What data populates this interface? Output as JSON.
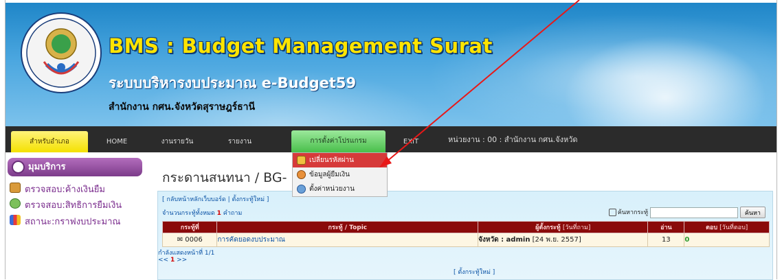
{
  "banner": {
    "title": "BMS : Budget Management Surat",
    "subtitle": "ระบบบริหารงบประมาณ e-Budget59",
    "office": "สำนักงาน กศน.จังหวัดสุราษฎร์ธานี"
  },
  "menu": {
    "items": [
      {
        "label": "สำหรับอำเภอ"
      },
      {
        "label": "HOME"
      },
      {
        "label": "งานรายวัน"
      },
      {
        "label": "รายงาน"
      },
      {
        "label": "การตั้งค่าโปรแกรม"
      },
      {
        "label": "EXIT"
      }
    ],
    "unit": "หน่วยงาน : 00 : สำนักงาน กศน.จังหวัด"
  },
  "dropdown": {
    "items": [
      {
        "label": "เปลี่ยนรหัสผ่าน"
      },
      {
        "label": "ข้อมูลผู้ยืมเงิน"
      },
      {
        "label": "ตั้งค่าหน่วยงาน"
      }
    ]
  },
  "sidebar": {
    "header": "มุมบริการ",
    "links": [
      {
        "label": "ตรวจสอบ:ค้างเงินยืม"
      },
      {
        "label": "ตรวจสอบ:สิทธิการยืมเงิน"
      },
      {
        "label": "สถานะ:กราฟงบประมาณ"
      }
    ]
  },
  "main": {
    "title": "กระดานสนทนา / BG-",
    "nav_links": "[ กลับหน้าหลักเว็บบอร์ด | ตั้งกระทู้ใหม่ ]",
    "count_prefix": "จำนวนกระทู้ทั้งหมด",
    "count_value": "1",
    "count_suffix": "คำถาม",
    "search_label": "ค้นหากระทู้",
    "search_button": "ค้นหา",
    "search_value": "",
    "table": {
      "headers": {
        "no": "กระทู้ที่",
        "topic": "กระทู้ / Topic",
        "author": "ผู้ตั้งกระทู้",
        "author_sub": "[วันที่ถาม]",
        "reads": "อ่าน",
        "replies": "ตอบ",
        "replies_sub": "[วันที่ตอบ]"
      },
      "rows": [
        {
          "no": "0006",
          "topic": "การคัดยอดงบประมาณ",
          "author": "จังหวัด : admin",
          "date": "[24 พ.ย. 2557]",
          "reads": "13",
          "replies": "0"
        }
      ]
    },
    "pager_text": "กำลังแสดงหน้าที่ 1/1",
    "pager_prev": "<<",
    "pager_page": "1",
    "pager_next": ">>",
    "new_topic_bottom": "[ ตั้งกระทู้ใหม่ ]"
  }
}
